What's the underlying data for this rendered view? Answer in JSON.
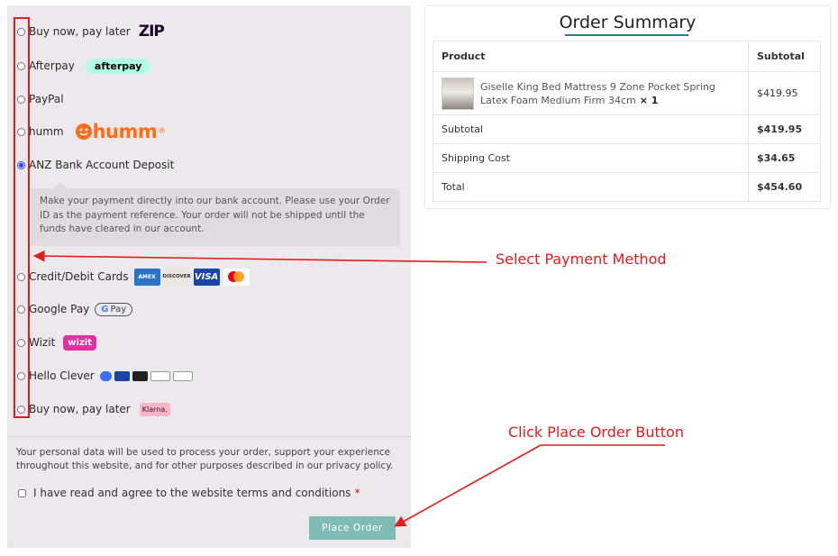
{
  "payment": {
    "methods": [
      {
        "label": "Buy now, pay later",
        "logo": "zip-logo"
      },
      {
        "label": "Afterpay",
        "logo": "afterpay-logo"
      },
      {
        "label": "PayPal",
        "logo": ""
      },
      {
        "label": "humm",
        "logo": "humm-logo"
      },
      {
        "label": "ANZ Bank Account Deposit",
        "logo": "",
        "selected": true
      },
      {
        "label": "Credit/Debit Cards",
        "logo": "card-logos"
      },
      {
        "label": "Google Pay",
        "logo": "gpay-logo"
      },
      {
        "label": "Wizit",
        "logo": "wizit-logo"
      },
      {
        "label": "Hello Clever",
        "logo": "hello-clever-logos"
      },
      {
        "label": "Buy now, pay later",
        "logo": "klarna-logo"
      }
    ],
    "logos": {
      "zip": "ZIP",
      "afterpay": "afterpay",
      "humm": "humm",
      "gpay": "Pay",
      "wizit": "wizit",
      "klarna": "Klarna."
    },
    "bank_description": "Make your payment directly into our bank account. Please use your Order ID as the payment reference. Your order will not be shipped until the funds have cleared in our account.",
    "privacy_text": "Your personal data will be used to process your order, support your experience throughout this website, and for other purposes described in our privacy policy.",
    "terms_label": "I have read and agree to the website terms and conditions",
    "required_mark": "*",
    "place_order_label": "Place Order"
  },
  "summary": {
    "title": "Order Summary",
    "col_product": "Product",
    "col_subtotal": "Subtotal",
    "item": {
      "name": "Giselle King Bed Mattress 9 Zone Pocket Spring Latex Foam Medium Firm 34cm",
      "qty": "× 1",
      "price": "$419.95"
    },
    "rows": [
      {
        "label": "Subtotal",
        "value": "$419.95"
      },
      {
        "label": "Shipping Cost",
        "value": "$34.65"
      },
      {
        "label": "Total",
        "value": "$454.60"
      }
    ]
  },
  "annotations": {
    "select_payment": "Select Payment Method",
    "click_place_order": "Click Place Order Button"
  },
  "colors": {
    "annotation": "#e21b1b",
    "place_order_button": "#7fbcb4",
    "accent": "#0e8c8c"
  }
}
